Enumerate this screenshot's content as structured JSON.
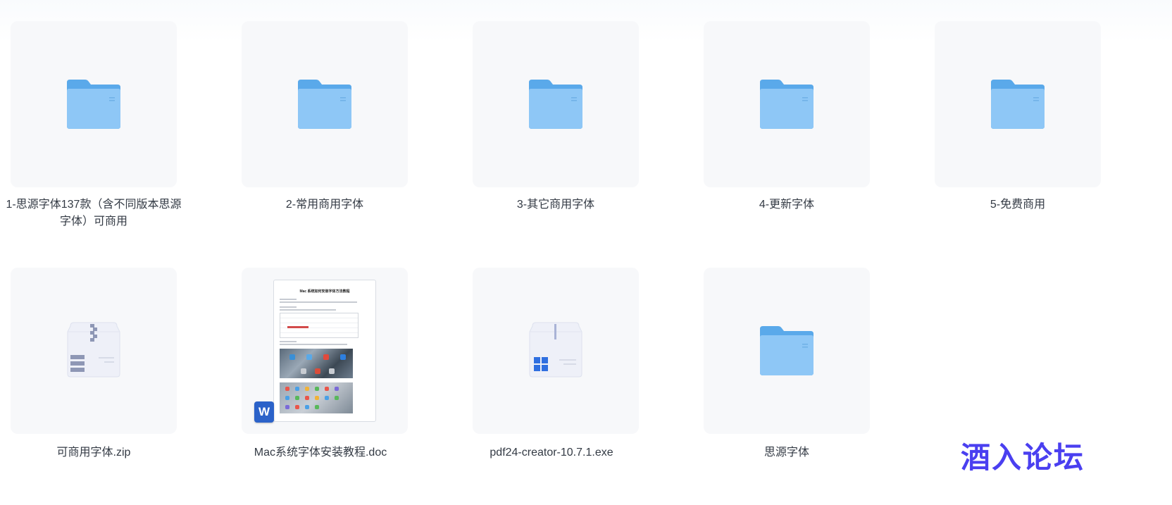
{
  "files": [
    {
      "name": "1-思源字体137款（含不同版本思源字体）可商用",
      "type": "folder"
    },
    {
      "name": "2-常用商用字体",
      "type": "folder"
    },
    {
      "name": "3-其它商用字体",
      "type": "folder"
    },
    {
      "name": "4-更新字体",
      "type": "folder"
    },
    {
      "name": "5-免费商用",
      "type": "folder"
    },
    {
      "name": "可商用字体.zip",
      "type": "zip"
    },
    {
      "name": "Mac系统字体安装教程.doc",
      "type": "doc"
    },
    {
      "name": "pdf24-creator-10.7.1.exe",
      "type": "exe"
    },
    {
      "name": "思源字体",
      "type": "folder"
    }
  ],
  "doc_preview": {
    "title": "Mac 系统如何安装字体方法教程",
    "badge": "W"
  },
  "watermark": "酒入论坛",
  "colors": {
    "folder_back": "#5aa9ea",
    "folder_front": "#8ec7f6",
    "tile_bg": "#f7f8fa",
    "label_text": "#333a44",
    "word_blue": "#2b62c9",
    "windows_blue": "#2f6fe0",
    "watermark": "#4a3ff0"
  }
}
